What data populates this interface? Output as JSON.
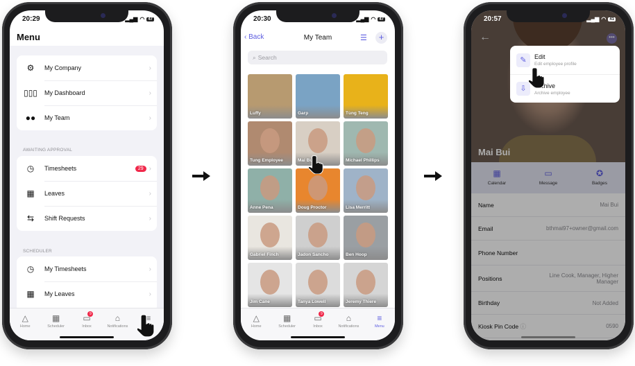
{
  "accent": "#5c5ce0",
  "badge_color": "#f0284a",
  "tabbar": {
    "items": [
      {
        "label": "Home",
        "icon": "home-icon"
      },
      {
        "label": "Scheduler",
        "icon": "calendar-icon"
      },
      {
        "label": "Inbox",
        "icon": "inbox-icon",
        "badge": "9"
      },
      {
        "label": "Notifications",
        "icon": "bell-icon"
      },
      {
        "label": "Menu",
        "icon": "menu-icon"
      }
    ]
  },
  "screen1": {
    "time": "20:29",
    "battery": "47",
    "title": "Menu",
    "card1": [
      {
        "label": "My Company",
        "icon": "gear-icon"
      },
      {
        "label": "My Dashboard",
        "icon": "dashboard-icon"
      },
      {
        "label": "My Team",
        "icon": "team-icon"
      }
    ],
    "section2": "AWAITING APPROVAL",
    "card2": [
      {
        "label": "Timesheets",
        "icon": "clock-check-icon",
        "badge": "29"
      },
      {
        "label": "Leaves",
        "icon": "calendar-leave-icon"
      },
      {
        "label": "Shift Requests",
        "icon": "swap-icon"
      }
    ],
    "section3": "SCHEDULER",
    "card3": [
      {
        "label": "My Timesheets",
        "icon": "clock-icon"
      },
      {
        "label": "My Leaves",
        "icon": "calendar-leave-icon"
      }
    ]
  },
  "screen2": {
    "time": "20:30",
    "battery": "47",
    "back": "Back",
    "title": "My Team",
    "search_placeholder": "Search",
    "members": [
      {
        "name": "Luffy",
        "bg": "#b79a70"
      },
      {
        "name": "Garp",
        "bg": "#7aa3c4"
      },
      {
        "name": "Tùng Teng",
        "bg": "#e8b21a"
      },
      {
        "name": "Tung Employee",
        "bg": "#b08a70"
      },
      {
        "name": "Mai Bui",
        "bg": "#d8cfc4"
      },
      {
        "name": "Michael Phillips",
        "bg": "#9fb8b0"
      },
      {
        "name": "Anne Pena",
        "bg": "#8fb0a8"
      },
      {
        "name": "Doug Proctor",
        "bg": "#e8862e"
      },
      {
        "name": "Lisa Merritt",
        "bg": "#9fb3c8"
      },
      {
        "name": "Gabriel Finch",
        "bg": "#e9e6e0"
      },
      {
        "name": "Jadon Sancho",
        "bg": "#cfcfcf"
      },
      {
        "name": "Ben Hoop",
        "bg": "#9a9fa3"
      },
      {
        "name": "Jim Cane",
        "bg": "#e5e5e5"
      },
      {
        "name": "Tanya Lowell",
        "bg": "#dcdcdc"
      },
      {
        "name": "Jeremy Thiere",
        "bg": "#d5d5d5"
      }
    ]
  },
  "screen3": {
    "time": "20:57",
    "battery": "41",
    "employee_name": "Mai Bui",
    "menu": [
      {
        "title": "Edit",
        "subtitle": "Edit employee profile",
        "icon": "edit-icon"
      },
      {
        "title": "Archive",
        "subtitle": "Archive employee",
        "icon": "archive-icon"
      }
    ],
    "actions": [
      {
        "label": "Calendar",
        "icon": "calendar-icon"
      },
      {
        "label": "Message",
        "icon": "message-icon"
      },
      {
        "label": "Badges",
        "icon": "star-badge-icon"
      }
    ],
    "fields": [
      {
        "label": "Name",
        "value": "Mai Bui"
      },
      {
        "label": "Email",
        "value": "bthmai97+owner@gmail.com"
      },
      {
        "label": "Phone Number",
        "value": ""
      },
      {
        "label": "Positions",
        "value": "Line Cook, Manager, Higher Manager"
      },
      {
        "label": "Birthday",
        "value": "Not Added"
      },
      {
        "label": "Kiosk Pin Code",
        "value": "0590"
      }
    ]
  }
}
